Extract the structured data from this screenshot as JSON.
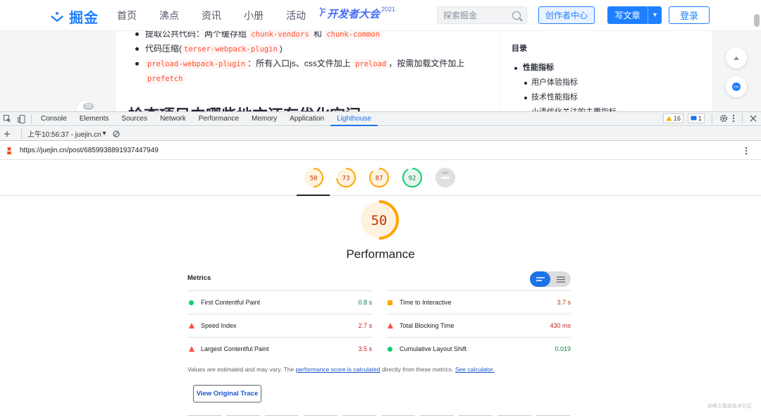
{
  "site": {
    "logo_text": "掘金",
    "nav": [
      "首页",
      "沸点",
      "资讯",
      "小册",
      "活动"
    ],
    "event": {
      "text": "开发者大会",
      "year": "2021"
    },
    "search_placeholder": "探索掘金",
    "creator_button": "创作者中心",
    "write_button": "写文章",
    "login_button": "登录",
    "accent_color": "#1e80ff"
  },
  "article": {
    "list": [
      {
        "pre": "提取公共代码：两个缓存组 ",
        "code1": "chunk-vendors",
        "mid": " 和 ",
        "code2": "chunk-common"
      },
      {
        "pre": "代码压缩(",
        "code1": "terser-webpack-plugin",
        "post": ")"
      },
      {
        "code1": "preload-webpack-plugin",
        "mid": "：所有入口js、css文件加上 ",
        "code2": "preload",
        "post": "，按需加载文件加上",
        "code3": "prefetch"
      }
    ],
    "heading": "检查项目中哪些地方还有优化空间",
    "comment_count": "28"
  },
  "toc": {
    "title": "目录",
    "items": [
      {
        "label": "性能指标",
        "level": 1
      },
      {
        "label": "用户体验指标",
        "level": 2
      },
      {
        "label": "技术性能指标",
        "level": 2
      },
      {
        "label": "小清优化关注的主要指标",
        "level": 2
      }
    ]
  },
  "devtools": {
    "tabs": [
      "Console",
      "Elements",
      "Sources",
      "Network",
      "Performance",
      "Memory",
      "Application",
      "Lighthouse"
    ],
    "active_tab": "Lighthouse",
    "warnings_count": "16",
    "messages_count": "1",
    "report_label": "上午10:56:37 - juejin.cn",
    "url": "https://juejin.cn/post/6859938891937447949"
  },
  "lighthouse": {
    "scores": [
      {
        "value": "50",
        "color": "#ffa400"
      },
      {
        "value": "73",
        "color": "#ffa400"
      },
      {
        "value": "87",
        "color": "#ffa400"
      },
      {
        "value": "92",
        "color": "#0cce6b"
      },
      {
        "value": "PWA",
        "color": "#cccccc"
      }
    ],
    "main_score": "50",
    "main_title": "Performance",
    "metrics_title": "Metrics",
    "metrics": [
      {
        "name": "First Contentful Paint",
        "value": "0.8 s",
        "rating": "pass"
      },
      {
        "name": "Time to Interactive",
        "value": "3.7 s",
        "rating": "average"
      },
      {
        "name": "Speed Index",
        "value": "2.7 s",
        "rating": "fail"
      },
      {
        "name": "Total Blocking Time",
        "value": "430 ms",
        "rating": "fail"
      },
      {
        "name": "Largest Contentful Paint",
        "value": "3.5 s",
        "rating": "fail"
      },
      {
        "name": "Cumulative Layout Shift",
        "value": "0.019",
        "rating": "pass"
      }
    ],
    "note_prefix": "Values are estimated and may vary. The ",
    "note_link1": "performance score is calculated",
    "note_mid": " directly from these metrics. ",
    "note_link2": "See calculator.",
    "trace_button": "View Original Trace",
    "watermark": "@稀土掘金技术社区"
  }
}
